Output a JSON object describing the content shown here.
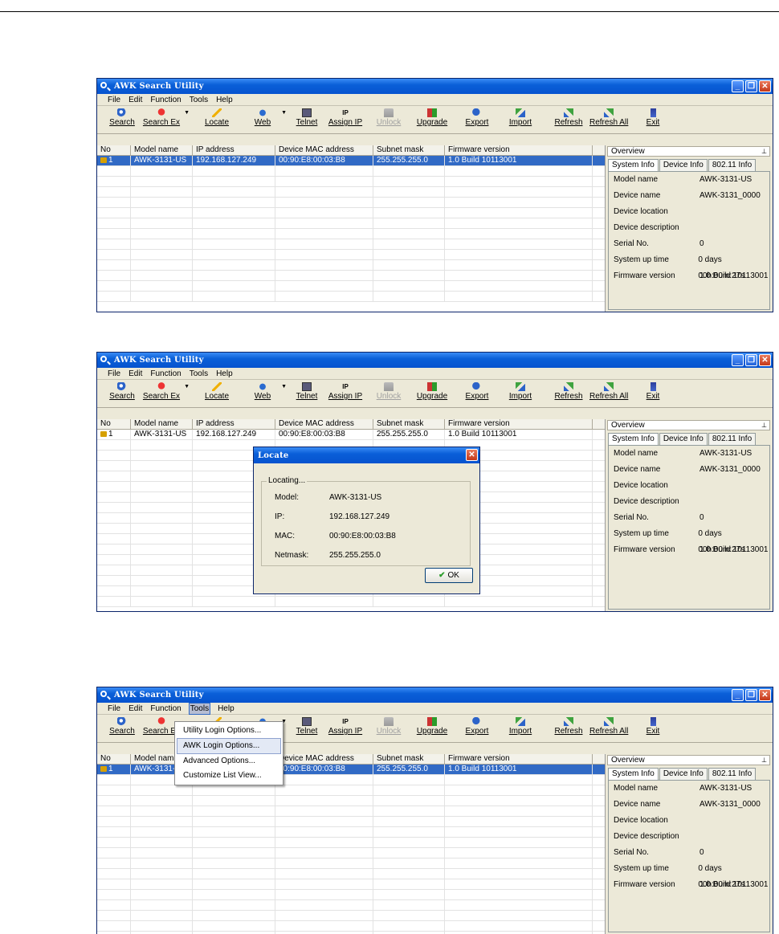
{
  "app_title": "AWK Search Utility",
  "menu": [
    "File",
    "Edit",
    "Function",
    "Tools",
    "Help"
  ],
  "toolbar": [
    {
      "label": "Search",
      "icon": "search-icon"
    },
    {
      "label": "Search Ex",
      "icon": "search-ex-icon"
    },
    {
      "label": "Locate",
      "icon": "locate-icon"
    },
    {
      "label": "Web",
      "icon": "web-icon"
    },
    {
      "label": "Telnet",
      "icon": "telnet-icon"
    },
    {
      "label": "Assign IP",
      "icon": "assign-ip-icon"
    },
    {
      "label": "Unlock",
      "icon": "unlock-icon"
    },
    {
      "label": "Upgrade",
      "icon": "upgrade-icon"
    },
    {
      "label": "Export",
      "icon": "export-icon"
    },
    {
      "label": "Import",
      "icon": "import-icon"
    },
    {
      "label": "Refresh",
      "icon": "refresh-icon"
    },
    {
      "label": "Refresh All",
      "icon": "refresh-all-icon"
    },
    {
      "label": "Exit",
      "icon": "exit-icon"
    }
  ],
  "columns": [
    "No",
    "Model name",
    "IP address",
    "Device MAC address",
    "Subnet mask",
    "Firmware version"
  ],
  "device": {
    "no": "1",
    "model": "AWK-3131-US",
    "ip": "192.168.127.249",
    "mac": "00:90:E8:00:03:B8",
    "subnet": "255.255.255.0",
    "firmware": "1.0 Build 10113001"
  },
  "overview": {
    "title": "Overview",
    "tabs": [
      "System Info",
      "Device Info",
      "802.11 Info"
    ],
    "rows": [
      {
        "k": "Model name",
        "v": "AWK-3131-US"
      },
      {
        "k": "Device name",
        "v": "AWK-3131_0000"
      },
      {
        "k": "Device location",
        "v": ""
      },
      {
        "k": "Device description",
        "v": ""
      },
      {
        "k": "Serial No.",
        "v": "0"
      },
      {
        "k": "System up time",
        "v": "0 days 00h:00m:27s"
      },
      {
        "k": "Firmware version",
        "v": "1.0 Build 10113001"
      }
    ]
  },
  "locate_dialog": {
    "title": "Locate",
    "group": "Locating...",
    "rows": [
      {
        "k": "Model:",
        "v": "AWK-3131-US"
      },
      {
        "k": "IP:",
        "v": "192.168.127.249"
      },
      {
        "k": "MAC:",
        "v": "00:90:E8:00:03:B8"
      },
      {
        "k": "Netmask:",
        "v": "255.255.255.0"
      }
    ],
    "ok": "OK"
  },
  "tools_menu": [
    "Utility Login Options...",
    "AWK Login Options...",
    "Advanced Options...",
    "Customize List View..."
  ],
  "colors": {
    "titlebar": "#0a5fd8",
    "selection": "#316ac5",
    "window_bg": "#ece9d8"
  }
}
